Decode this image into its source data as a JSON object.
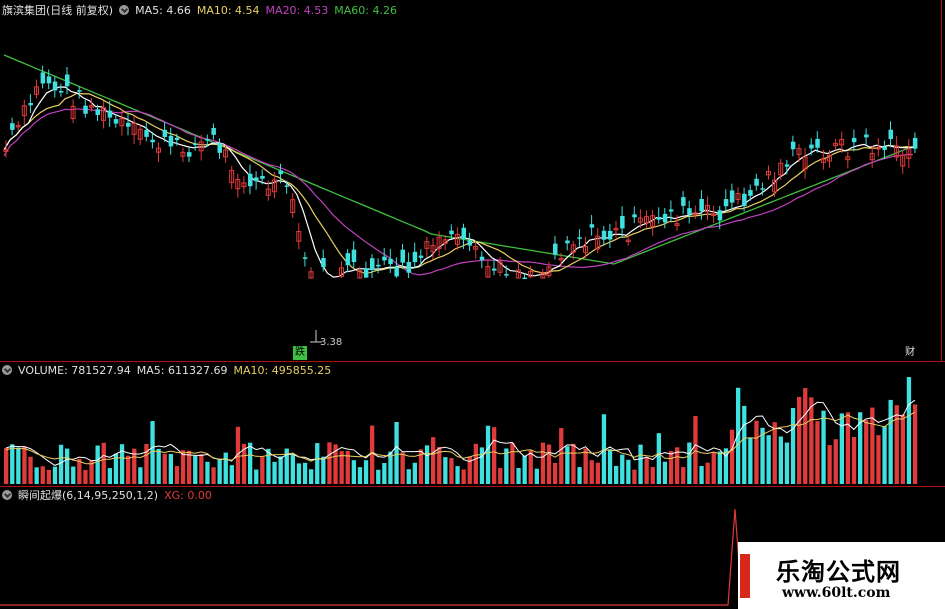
{
  "price_header": {
    "stock_name": "旗滨集团",
    "period": "(日线 前复权)",
    "ma5_label": "MA5:",
    "ma5_value": "4.66",
    "ma10_label": "MA10:",
    "ma10_value": "4.54",
    "ma20_label": "MA20:",
    "ma20_value": "4.53",
    "ma60_label": "MA60:",
    "ma60_value": "4.26"
  },
  "price_annotations": {
    "low_price": "3.38",
    "marker_die": "跌",
    "marker_cai": "财"
  },
  "volume_header": {
    "label": "VOLUME:",
    "value": "781527.94",
    "ma5_label": "MA5:",
    "ma5_value": "611327.69",
    "ma10_label": "MA10:",
    "ma10_value": "495855.25"
  },
  "indicator_header": {
    "label": "瞬间起爆(6,14,95,250,1,2)",
    "xg_label": "XG:",
    "xg_value": "0.00"
  },
  "watermark": {
    "title": "乐淘公式网",
    "url": "www.60lt.com"
  },
  "colors": {
    "up": "#e03a3a",
    "down": "#3fe0e0",
    "ma5": "#ffffff",
    "ma10": "#e8d060",
    "ma20": "#c040c0",
    "ma60": "#40c040",
    "separator": "#b01010",
    "background": "#000000"
  }
}
